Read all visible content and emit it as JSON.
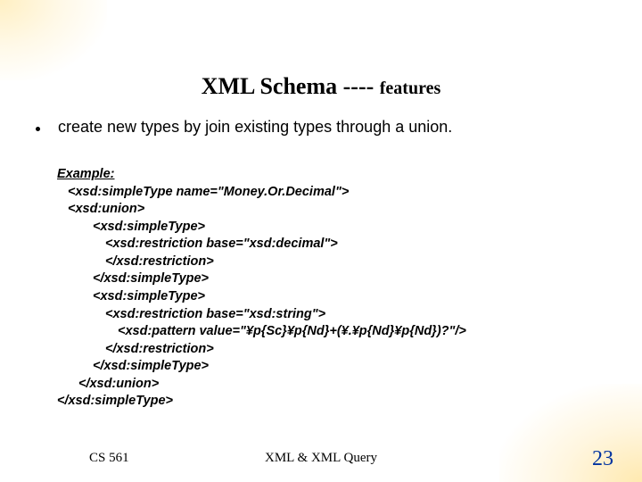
{
  "title": {
    "main": "XML Schema",
    "dashes": "----",
    "sub": "features"
  },
  "bullet": "create new types by join existing types through a union.",
  "example": {
    "label": "Example:",
    "lines": [
      {
        "indent": "i1",
        "text": "<xsd:simpleType name=\"Money.Or.Decimal\">"
      },
      {
        "indent": "i1",
        "text": "<xsd:union>"
      },
      {
        "indent": "i3",
        "text": "<xsd:simpleType>"
      },
      {
        "indent": "i4",
        "text": "<xsd:restriction base=\"xsd:decimal\">"
      },
      {
        "indent": "i4",
        "text": "</xsd:restriction>"
      },
      {
        "indent": "i3",
        "text": "</xsd:simpleType>"
      },
      {
        "indent": "i3",
        "text": "<xsd:simpleType>"
      },
      {
        "indent": "i4",
        "text": "<xsd:restriction base=\"xsd:string\">"
      },
      {
        "indent": "i5",
        "text": "<xsd:pattern value=\"¥p{Sc}¥p{Nd}+(¥.¥p{Nd}¥p{Nd})?\"/>"
      },
      {
        "indent": "i4",
        "text": "</xsd:restriction>"
      },
      {
        "indent": "i3",
        "text": "</xsd:simpleType>"
      },
      {
        "indent": "i2",
        "text": "</xsd:union>"
      },
      {
        "indent": "",
        "text": "</xsd:simpleType>"
      }
    ]
  },
  "footer": {
    "left": "CS 561",
    "center": "XML & XML Query",
    "page": "23"
  }
}
